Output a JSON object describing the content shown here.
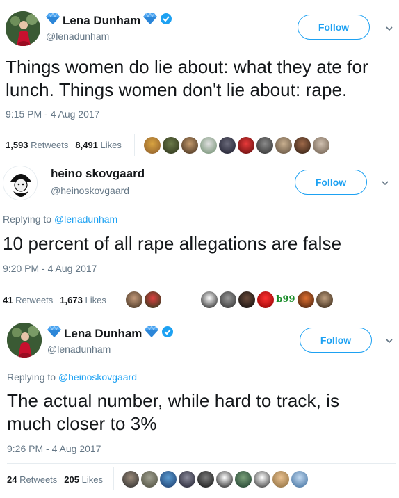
{
  "tweets": [
    {
      "name": "Lena Dunham",
      "handle": "@lenadunham",
      "follow_label": "Follow",
      "text": "Things women do lie about: what they ate for lunch. Things women don't lie about: rape.",
      "timestamp": "9:15 PM - 4 Aug 2017",
      "retweets_count": "1,593",
      "retweets_label": "Retweets",
      "likes_count": "8,491",
      "likes_label": "Likes"
    },
    {
      "name": "heino skovgaard",
      "handle": "@heinoskovgaard",
      "follow_label": "Follow",
      "reply_prefix": "Replying to",
      "reply_handle": "@lenadunham",
      "text": "10 percent of all rape allegations are false",
      "timestamp": "9:20 PM - 4 Aug 2017",
      "retweets_count": "41",
      "retweets_label": "Retweets",
      "likes_count": "1,673",
      "likes_label": "Likes",
      "liker_tag": "b99"
    },
    {
      "name": "Lena Dunham",
      "handle": "@lenadunham",
      "follow_label": "Follow",
      "reply_prefix": "Replying to",
      "reply_handle": "@heinoskovgaard",
      "text": "The actual number, while hard to track, is much closer to 3%",
      "timestamp": "9:26 PM - 4 Aug 2017",
      "retweets_count": "24",
      "retweets_label": "Retweets",
      "likes_count": "205",
      "likes_label": "Likes"
    }
  ],
  "colors": {
    "accent": "#1da1f2",
    "verified": "#1da1f2",
    "diamond": "#4aa3f0",
    "muted": "#657786",
    "divider": "#e6ecf0"
  },
  "icons": {
    "diamond": "diamond-emoji-icon",
    "verified": "verified-badge-icon",
    "chevron": "chevron-down-icon"
  }
}
